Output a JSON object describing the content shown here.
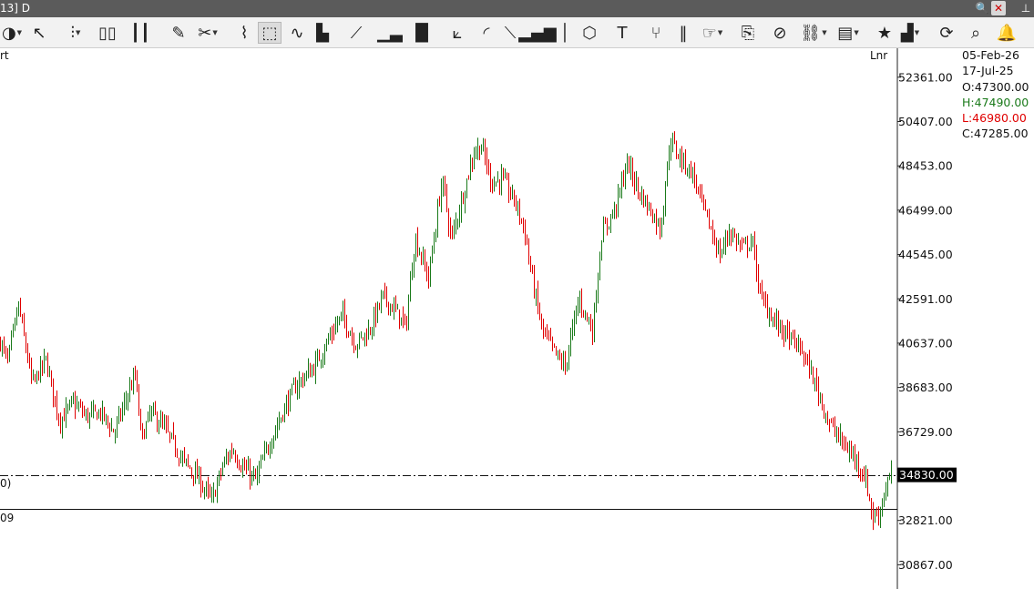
{
  "window": {
    "title": "13] D",
    "controls": [
      {
        "name": "search-icon",
        "glyph": "🔍"
      },
      {
        "name": "close-icon",
        "glyph": "✕"
      },
      {
        "name": "pin-icon",
        "glyph": "⊥"
      }
    ]
  },
  "toolbar": [
    {
      "name": "chart-menu-icon",
      "glyph": "◑",
      "caret": true
    },
    {
      "name": "cursor-icon",
      "glyph": "↖"
    },
    {
      "name": "bar-chart-icon",
      "glyph": "⫶",
      "caret": true
    },
    {
      "name": "bars-icon",
      "glyph": "▯▯"
    },
    {
      "name": "candle-icon",
      "glyph": "┃┃"
    },
    {
      "name": "ruler-icon",
      "glyph": "✎"
    },
    {
      "name": "scissors-icon",
      "glyph": "✂",
      "caret": true
    },
    {
      "name": "erase-icon",
      "glyph": "⌇"
    },
    {
      "name": "crop-icon",
      "glyph": "⬚",
      "active": true
    },
    {
      "name": "trend-icon",
      "glyph": "∿"
    },
    {
      "name": "histogram-icon",
      "glyph": "▙"
    },
    {
      "name": "line-icon",
      "glyph": "⟋"
    },
    {
      "name": "volume-icon",
      "glyph": "▁▃"
    },
    {
      "name": "heikin-icon",
      "glyph": "▐▌"
    },
    {
      "name": "fan-icon",
      "glyph": "⟀"
    },
    {
      "name": "arc-icon",
      "glyph": "◜"
    },
    {
      "name": "measure-icon",
      "glyph": "⟍"
    },
    {
      "name": "signal-icon",
      "glyph": "▂▄▆"
    },
    {
      "name": "cursor-line-icon",
      "glyph": "│"
    },
    {
      "name": "cube-icon",
      "glyph": "⬡"
    },
    {
      "name": "text-icon",
      "glyph": "T"
    },
    {
      "name": "fork-icon",
      "glyph": "⑂"
    },
    {
      "name": "columns-icon",
      "glyph": "‖"
    },
    {
      "name": "hand-icon",
      "glyph": "☞",
      "caret": true
    },
    {
      "name": "script-icon",
      "glyph": "⎘"
    },
    {
      "name": "remove-icon",
      "glyph": "⊘"
    },
    {
      "name": "link-icon",
      "glyph": "⛓",
      "caret": true
    },
    {
      "name": "book-icon",
      "glyph": "▤",
      "caret": true
    },
    {
      "name": "star-icon",
      "glyph": "★"
    },
    {
      "name": "layout-icon",
      "glyph": "▟",
      "caret": true
    },
    {
      "name": "sync-icon",
      "glyph": "⟳"
    },
    {
      "name": "zoom-icon",
      "glyph": "⌕"
    },
    {
      "name": "alert-icon",
      "glyph": "🔔"
    }
  ],
  "chart": {
    "top_left_label": "rt",
    "scale_label": "Lnr",
    "line_labels": [
      "0)",
      "09"
    ],
    "info": {
      "date1": "05-Feb-26",
      "date2": "17-Jul-25",
      "open": "O:47300.00",
      "high": "H:47490.00",
      "low": "L:46980.00",
      "close": "C:47285.00"
    },
    "colors": {
      "up": "#1a7a1a",
      "down": "#e00000",
      "neutral": "#111111",
      "axis": "#222222",
      "current_price_bg": "#000000",
      "current_price_fg": "#ffffff"
    }
  },
  "chart_data": {
    "type": "candlestick",
    "title": "",
    "ylabel": "",
    "y_ticks": [
      52361,
      50407,
      48453,
      46499,
      44545,
      42591,
      40637,
      38683,
      36729,
      32821,
      30867
    ],
    "y_tick_labels": [
      "52361.00",
      "50407.00",
      "48453.00",
      "46499.00",
      "44545.00",
      "42591.00",
      "40637.00",
      "38683.00",
      "36729.00",
      "32821.00",
      "30867.00"
    ],
    "ylim": [
      30200,
      54200
    ],
    "current_price": 34830,
    "current_price_label": "34830.00",
    "horizontal_lines": [
      {
        "value": 34830,
        "style": "dashdot"
      },
      {
        "value": 33330,
        "style": "solid"
      }
    ],
    "num_bars": 490,
    "price_path": [
      [
        0,
        40700
      ],
      [
        8,
        39800
      ],
      [
        20,
        42300
      ],
      [
        35,
        38800
      ],
      [
        50,
        39900
      ],
      [
        65,
        37200
      ],
      [
        80,
        38000
      ],
      [
        95,
        37400
      ],
      [
        110,
        37600
      ],
      [
        125,
        36700
      ],
      [
        140,
        38400
      ],
      [
        148,
        39200
      ],
      [
        155,
        36400
      ],
      [
        165,
        37600
      ],
      [
        180,
        36900
      ],
      [
        200,
        35500
      ],
      [
        215,
        34800
      ],
      [
        232,
        33700
      ],
      [
        245,
        35300
      ],
      [
        255,
        36000
      ],
      [
        265,
        35200
      ],
      [
        280,
        34600
      ],
      [
        295,
        36200
      ],
      [
        310,
        37600
      ],
      [
        325,
        38800
      ],
      [
        345,
        39600
      ],
      [
        360,
        40800
      ],
      [
        375,
        41900
      ],
      [
        390,
        40600
      ],
      [
        405,
        41200
      ],
      [
        420,
        42700
      ],
      [
        435,
        42000
      ],
      [
        445,
        41300
      ],
      [
        455,
        45300
      ],
      [
        470,
        43500
      ],
      [
        485,
        47900
      ],
      [
        495,
        45200
      ],
      [
        510,
        47500
      ],
      [
        520,
        49100
      ],
      [
        528,
        49300
      ],
      [
        540,
        47700
      ],
      [
        550,
        47900
      ],
      [
        565,
        46900
      ],
      [
        575,
        45700
      ],
      [
        585,
        43200
      ],
      [
        595,
        41200
      ],
      [
        610,
        40100
      ],
      [
        620,
        39600
      ],
      [
        635,
        42600
      ],
      [
        650,
        41200
      ],
      [
        660,
        45400
      ],
      [
        675,
        46600
      ],
      [
        688,
        48600
      ],
      [
        700,
        47400
      ],
      [
        712,
        46600
      ],
      [
        725,
        45700
      ],
      [
        735,
        49600
      ],
      [
        745,
        48900
      ],
      [
        760,
        48100
      ],
      [
        775,
        46200
      ],
      [
        790,
        44500
      ],
      [
        800,
        45600
      ],
      [
        815,
        44800
      ],
      [
        825,
        45200
      ],
      [
        835,
        42600
      ],
      [
        850,
        41600
      ],
      [
        865,
        40900
      ],
      [
        880,
        40300
      ],
      [
        895,
        38800
      ],
      [
        910,
        37100
      ],
      [
        925,
        36200
      ],
      [
        940,
        35500
      ],
      [
        950,
        34600
      ],
      [
        958,
        32900
      ],
      [
        965,
        33200
      ],
      [
        972,
        34300
      ],
      [
        978,
        34830
      ]
    ]
  }
}
